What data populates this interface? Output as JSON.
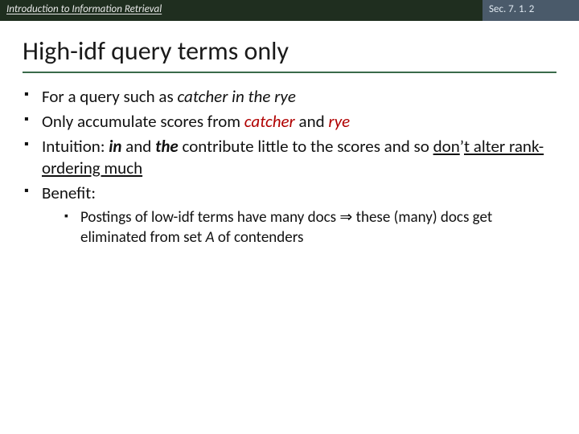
{
  "header": {
    "left": "Introduction to Information Retrieval",
    "right": "Sec. 7. 1. 2"
  },
  "title": "High-idf query terms only",
  "bullets": {
    "b1_pre": "For a query such as ",
    "b1_em": "catcher in the rye",
    "b2_pre": "Only accumulate scores from ",
    "b2_em1": "catcher",
    "b2_mid": " and ",
    "b2_em2": "rye",
    "b3_pre": "Intuition: ",
    "b3_bi1": "in",
    "b3_mid1": " and ",
    "b3_bi2": "the",
    "b3_mid2": " contribute little to the scores and so ",
    "b3_u1": "don",
    "b3_apos": "’",
    "b3_u2": "t alter rank-ordering much",
    "b4": "Benefit:",
    "sub_pre": "Postings of low-idf terms have many docs ",
    "sub_arrow": "⇒",
    "sub_post": " these (many) docs get eliminated from set ",
    "sub_em": "A",
    "sub_tail": " of contenders"
  }
}
